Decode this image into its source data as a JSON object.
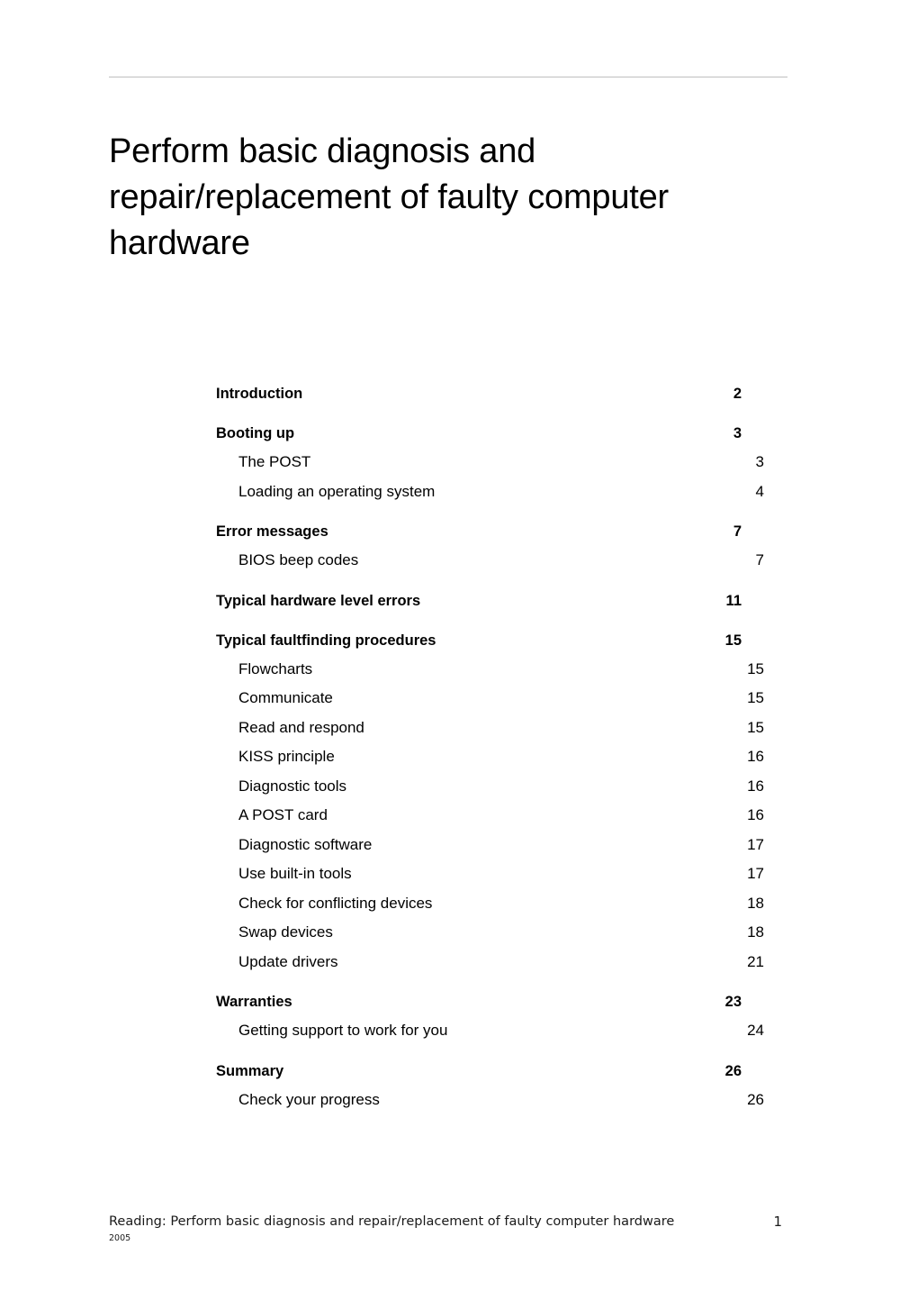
{
  "document": {
    "title": "Perform basic diagnosis and repair/replacement of faulty computer hardware",
    "header_rule_color": "#bfbfbf",
    "background_color": "#ffffff",
    "text_color": "#000000"
  },
  "toc": {
    "groups": [
      {
        "entries": [
          {
            "level": 1,
            "label": "Introduction",
            "page": "2"
          }
        ]
      },
      {
        "entries": [
          {
            "level": 1,
            "label": "Booting up",
            "page": "3"
          },
          {
            "level": 2,
            "label": "The POST",
            "page": "3"
          },
          {
            "level": 2,
            "label": "Loading an operating system",
            "page": "4"
          }
        ]
      },
      {
        "entries": [
          {
            "level": 1,
            "label": "Error messages",
            "page": "7"
          },
          {
            "level": 2,
            "label": "BIOS beep codes",
            "page": "7"
          }
        ]
      },
      {
        "entries": [
          {
            "level": 1,
            "label": "Typical hardware level errors",
            "page": "11"
          }
        ]
      },
      {
        "entries": [
          {
            "level": 1,
            "label": "Typical faultfinding procedures",
            "page": "15"
          },
          {
            "level": 2,
            "label": "Flowcharts",
            "page": "15"
          },
          {
            "level": 2,
            "label": "Communicate",
            "page": "15"
          },
          {
            "level": 2,
            "label": "Read and respond",
            "page": "15"
          },
          {
            "level": 2,
            "label": "KISS principle",
            "page": "16"
          },
          {
            "level": 2,
            "label": "Diagnostic tools",
            "page": "16"
          },
          {
            "level": 2,
            "label": "A POST card",
            "page": "16"
          },
          {
            "level": 2,
            "label": "Diagnostic software",
            "page": "17"
          },
          {
            "level": 2,
            "label": "Use built-in tools",
            "page": "17"
          },
          {
            "level": 2,
            "label": "Check for conflicting devices",
            "page": "18"
          },
          {
            "level": 2,
            "label": "Swap devices",
            "page": "18"
          },
          {
            "level": 2,
            "label": "Update drivers",
            "page": "21"
          }
        ]
      },
      {
        "entries": [
          {
            "level": 1,
            "label": "Warranties",
            "page": "23"
          },
          {
            "level": 2,
            "label": "Getting support to work for you",
            "page": "24"
          }
        ]
      },
      {
        "entries": [
          {
            "level": 1,
            "label": "Summary",
            "page": "26"
          },
          {
            "level": 2,
            "label": "Check your progress",
            "page": "26"
          }
        ]
      }
    ]
  },
  "footer": {
    "text": "Reading: Perform basic diagnosis and repair/replacement of faulty computer hardware",
    "page_number": "1",
    "year": "2005"
  }
}
